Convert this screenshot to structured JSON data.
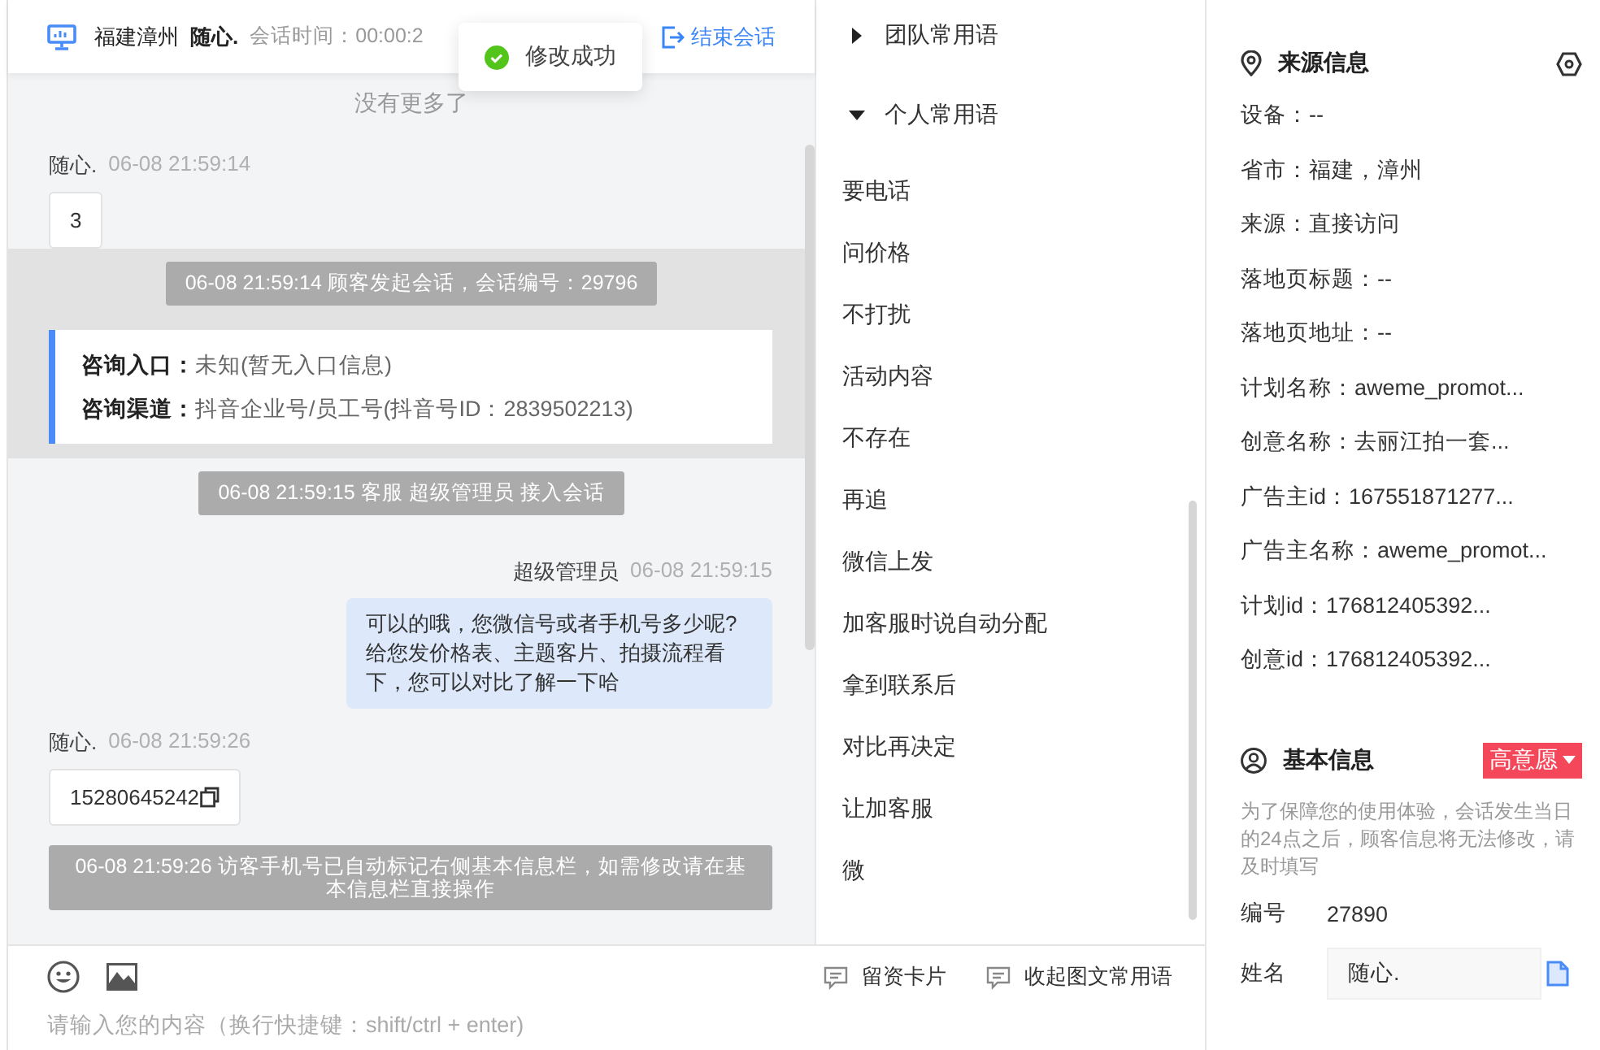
{
  "header": {
    "location": "福建漳州",
    "visitor": "随心.",
    "session_time": "会话时间：00:00:2",
    "end_button": "结束会话"
  },
  "toast": {
    "text": "修改成功"
  },
  "chat": {
    "load_more": "没有更多了",
    "messages": [
      {
        "kind": "visitor",
        "name": "随心.",
        "time": "06-08 21:59:14",
        "text": "3",
        "copyable": false
      },
      {
        "kind": "system",
        "text": "06-08 21:59:14 顾客发起会话，会话编号：29796",
        "band": true
      },
      {
        "kind": "info_card",
        "band": true,
        "rows": [
          {
            "label": "咨询入口：",
            "value": "未知(暂无入口信息)"
          },
          {
            "label": "咨询渠道：",
            "value": "抖音企业号/员工号(抖音号ID：2839502213)"
          }
        ]
      },
      {
        "kind": "system",
        "text": "06-08 21:59:15 客服 超级管理员 接入会话",
        "band": false
      },
      {
        "kind": "agent",
        "name": "超级管理员",
        "time": "06-08 21:59:15",
        "text": "可以的哦，您微信号或者手机号多少呢?给您发价格表、主题客片、拍摄流程看下，您可以对比了解一下哈"
      },
      {
        "kind": "visitor",
        "name": "随心.",
        "time": "06-08 21:59:26",
        "text": "15280645242",
        "copyable": true
      },
      {
        "kind": "notice",
        "text": "06-08 21:59:26 访客手机号已自动标记右侧基本信息栏，如需修改请在基本信息栏直接操作"
      }
    ]
  },
  "phrases": {
    "groups": [
      {
        "label": "团队常用语",
        "expanded": false
      },
      {
        "label": "个人常用语",
        "expanded": true,
        "items": [
          "要电话",
          "问价格",
          "不打扰",
          "活动内容",
          "不存在",
          "再追",
          "微信上发",
          "加客服时说自动分配",
          "拿到联系后",
          "对比再决定",
          "让加客服",
          "微"
        ]
      }
    ]
  },
  "composer": {
    "actions": [
      "留资卡片",
      "收起图文常用语"
    ],
    "placeholder": "请输入您的内容（换行快捷键：shift/ctrl + enter)"
  },
  "source_info": {
    "title": "来源信息",
    "fields": [
      "设备：--",
      "省市：福建，漳州",
      "来源：直接访问",
      "落地页标题：--",
      "落地页地址：--",
      "计划名称：aweme_promot...",
      "创意名称：去丽江拍一套...",
      "广告主id：167551871277...",
      "广告主名称：aweme_promot...",
      "计划id：176812405392...",
      "创意id：176812405392..."
    ]
  },
  "basic_info": {
    "title": "基本信息",
    "intent_tag": "高意愿",
    "notice": "为了保障您的使用体验，会话发生当日的24点之后，顾客信息将无法修改，请及时填写",
    "fields": [
      {
        "kind": "text",
        "label": "编号",
        "value": "27890"
      },
      {
        "kind": "input",
        "label": "姓名",
        "value": "随心."
      }
    ]
  }
}
